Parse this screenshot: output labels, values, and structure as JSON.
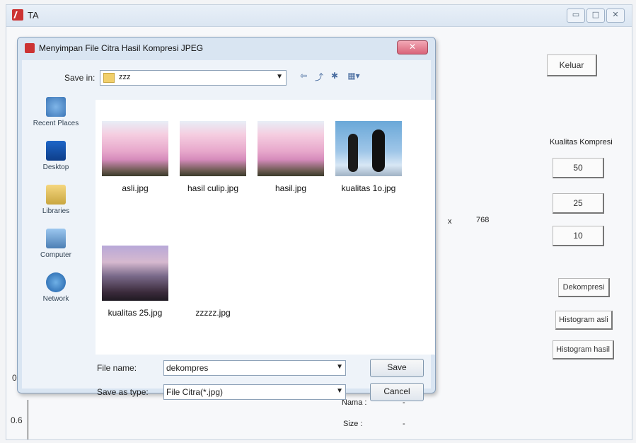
{
  "app": {
    "title": "TA",
    "win_buttons": [
      "▭",
      "□",
      "✕"
    ],
    "buttons": {
      "keluar": "Keluar",
      "q50": "50",
      "q25": "25",
      "q10": "10",
      "dekompresi": "Dekompresi",
      "histogram_asli": "Histogram asli",
      "histogram_hasil": "Histogram hasil"
    },
    "labels": {
      "kualitas": "Kualitas Kompresi",
      "x_char": "x",
      "width_value": "768",
      "nama_label": "Nama :",
      "nama_value": "-",
      "size_label": "Size :",
      "size_value": "-",
      "axis_0": "0",
      "axis_06": "0.6"
    }
  },
  "dialog": {
    "title": "Menyimpan File Citra Hasil Kompresi JPEG",
    "close": "✕",
    "save_in_label": "Save in:",
    "save_in_value": "zzz",
    "places": [
      "Recent Places",
      "Desktop",
      "Libraries",
      "Computer",
      "Network"
    ],
    "files": [
      {
        "name": "asli.jpg",
        "thumb": "flower"
      },
      {
        "name": "hasil culip.jpg",
        "thumb": "flower"
      },
      {
        "name": "hasil.jpg",
        "thumb": "flower"
      },
      {
        "name": "kualitas 1o.jpg",
        "thumb": "penguin"
      },
      {
        "name": "kualitas 25.jpg",
        "thumb": "landscape"
      },
      {
        "name": "zzzzz.jpg",
        "thumb": "empty"
      }
    ],
    "file_name_label": "File name:",
    "file_name_value": "dekompres",
    "save_type_label": "Save as type:",
    "save_type_value": "File Citra(*.jpg)",
    "save_button": "Save",
    "cancel_button": "Cancel"
  },
  "colors": {
    "dialog_bg": "#d9e5f2",
    "close_red": "#d9647a"
  }
}
